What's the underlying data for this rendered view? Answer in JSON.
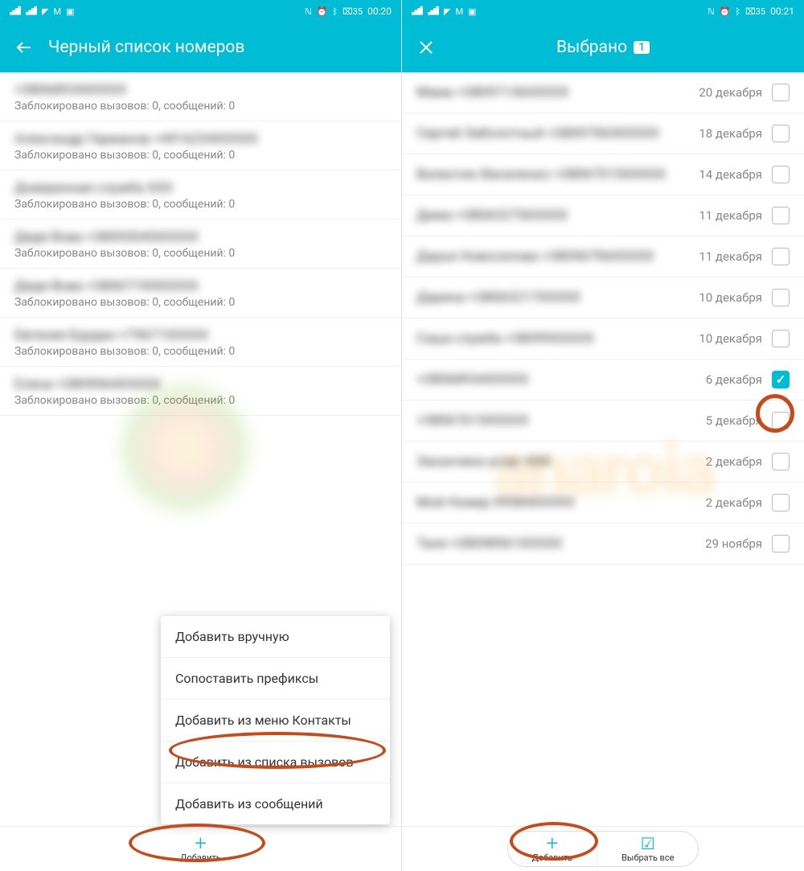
{
  "left": {
    "status": {
      "time": "00:20",
      "battery": "35"
    },
    "header": {
      "title": "Черный список номеров"
    },
    "blocked_template": "Заблокировано вызовов: 0, сообщений: 0",
    "items": [
      {
        "name": "+38068934XXXXX"
      },
      {
        "name": "Александр Германов +4916234XXXXX"
      },
      {
        "name": "Доверенная служба XXX"
      },
      {
        "name": "Дядя Вова +38093045XXXXX"
      },
      {
        "name": "Дядя Вова +38067745XXXXX"
      },
      {
        "name": "Евгения Бурдан +79671XXXXX"
      },
      {
        "name": "Елена +3809964XXXXX"
      }
    ],
    "popup": {
      "items": [
        "Добавить вручную",
        "Сопоставить префиксы",
        "Добавить из меню Контакты",
        "Добавить из списка вызовов",
        "Добавить из сообщений"
      ]
    },
    "bottom": {
      "add": "Добавить"
    }
  },
  "right": {
    "status": {
      "time": "00:21",
      "battery": "35"
    },
    "header": {
      "title": "Выбрано",
      "badge": "1"
    },
    "items": [
      {
        "name": "Мама +38097136XXXXX",
        "date": "20 декабря",
        "checked": false
      },
      {
        "name": "Сергей Заболотный +38097565XXXXX",
        "date": "18 декабря",
        "checked": false
      },
      {
        "name": "Валентин Василенко +38067015XXXXX",
        "date": "14 декабря",
        "checked": false
      },
      {
        "name": "Дима +38063275XXXXX",
        "date": "11 декабря",
        "checked": false
      },
      {
        "name": "Дарья Новоселова +38096796XXXXX",
        "date": "11 декабря",
        "checked": false
      },
      {
        "name": "Дарина +38063217XXXXX",
        "date": "10 декабря",
        "checked": false
      },
      {
        "name": "Саша служба +38099XXXXX",
        "date": "10 декабря",
        "checked": false
      },
      {
        "name": "+38068934XXXXX",
        "date": "6 декабря",
        "checked": true
      },
      {
        "name": "+38067615XXXXX",
        "date": "5 декабря",
        "checked": false
      },
      {
        "name": "Заказчики услуг XXX",
        "date": "2 декабря",
        "checked": false
      },
      {
        "name": "Мой Номер 09584XXXXX",
        "date": "2 декабря",
        "checked": false
      },
      {
        "name": "Таня +38098961XXXXX",
        "date": "29 ноября",
        "checked": false
      }
    ],
    "bottom": {
      "add": "Добавить",
      "select_all": "Выбрать все"
    }
  }
}
